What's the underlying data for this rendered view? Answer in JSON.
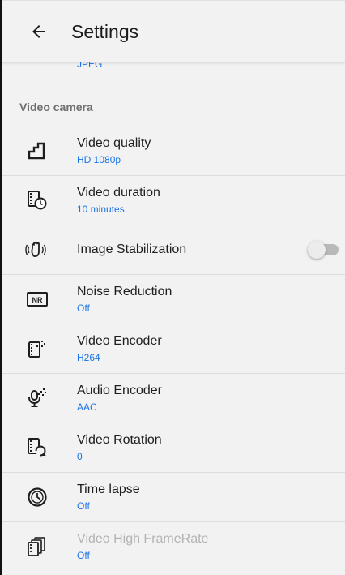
{
  "app_bar": {
    "title": "Settings",
    "back_icon": "arrow-back-icon"
  },
  "previous_item_summary": "JPEG",
  "section": {
    "title": "Video camera"
  },
  "items": [
    {
      "title": "Video quality",
      "summary": "HD 1080p",
      "icon": "video-quality-icon",
      "enabled": true
    },
    {
      "title": "Video duration",
      "summary": "10 minutes",
      "icon": "video-duration-icon",
      "enabled": true
    },
    {
      "title": "Image Stabilization",
      "summary": "",
      "icon": "stabilization-icon",
      "enabled": true,
      "toggle": false
    },
    {
      "title": "Noise Reduction",
      "summary": "Off",
      "icon": "noise-reduction-icon",
      "enabled": true
    },
    {
      "title": "Video Encoder",
      "summary": "H264",
      "icon": "video-encoder-icon",
      "enabled": true
    },
    {
      "title": "Audio Encoder",
      "summary": "AAC",
      "icon": "audio-encoder-icon",
      "enabled": true
    },
    {
      "title": "Video Rotation",
      "summary": "0",
      "icon": "video-rotation-icon",
      "enabled": true
    },
    {
      "title": "Time lapse",
      "summary": "Off",
      "icon": "time-lapse-icon",
      "enabled": true
    },
    {
      "title": "Video High FrameRate",
      "summary": "Off",
      "icon": "high-framerate-icon",
      "enabled": false
    }
  ],
  "colors": {
    "accent": "#1a73e8",
    "background": "#f2f2f2",
    "primary_text": "#1e1e1e",
    "section_header": "#6f6f6f",
    "disabled_text": "#b3b3b3"
  }
}
